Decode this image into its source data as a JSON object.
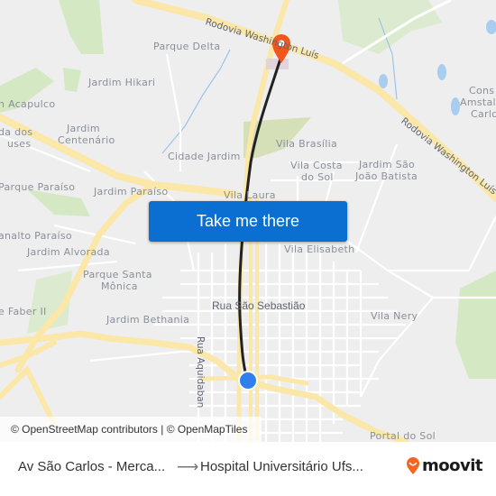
{
  "map": {
    "labels": {
      "parque_delta": "Parque Delta",
      "jardim_hikari": "Jardim Hikari",
      "acapulco": "n Acapulco",
      "jardim_centenario_1": "Jardim",
      "jardim_centenario_2": "Centenário",
      "da_dos_1": "da dos",
      "da_dos_2": "uses",
      "cidade_jardim": "Cidade Jardim",
      "vila_brasilia": "Vila Brasília",
      "vila_costa_1": "Vila Costa",
      "vila_costa_2": "do Sol",
      "jardim_sao_1": "Jardim São",
      "jardim_sao_2": "João Batista",
      "cons_1": "Cons",
      "cons_2": "Amstal",
      "cons_3": "Carlo",
      "parque_paraiso": "Parque Paraíso",
      "jardim_paraiso": "Jardim Paraíso",
      "vila_laura": "Vila Laura",
      "planalto_paraiso": "analto Paraíso",
      "jardim_alvorada": "Jardim Alvorada",
      "vila_elisabeth": "Vila Elisabeth",
      "parque_santa_1": "Parque Santa",
      "parque_santa_2": "Mônica",
      "faber": "e Faber II",
      "rua_sao_sebastiao": "Rua São Sebastião",
      "vila_nery": "Vila Nery",
      "jardim_bethania": "Jardim Bethania",
      "rua_aquidaban": "Rua Aquidaban",
      "portal_do_sol": "Portal do Sol",
      "rodovia_top": "Rodovia Washington Luís",
      "rodovia_right": "Rodovia Washington Luís"
    },
    "colors": {
      "background": "#eeeeef",
      "major_road": "#fbe7a8",
      "minor_road": "#ffffff",
      "park": "#cfe6bd",
      "water": "#a9cdef",
      "route": "#222222",
      "destination_marker": "#f2561d",
      "origin_marker": "#2f80ed"
    },
    "cta_button": "Take me there",
    "attribution": "© OpenStreetMap contributors | © OpenMapTiles"
  },
  "footer": {
    "from": "Av São Carlos - Merca...",
    "arrow": "⟶",
    "to": "Hospital Universitário Ufs...",
    "brand": "moovit",
    "brand_color": "#f26522"
  }
}
